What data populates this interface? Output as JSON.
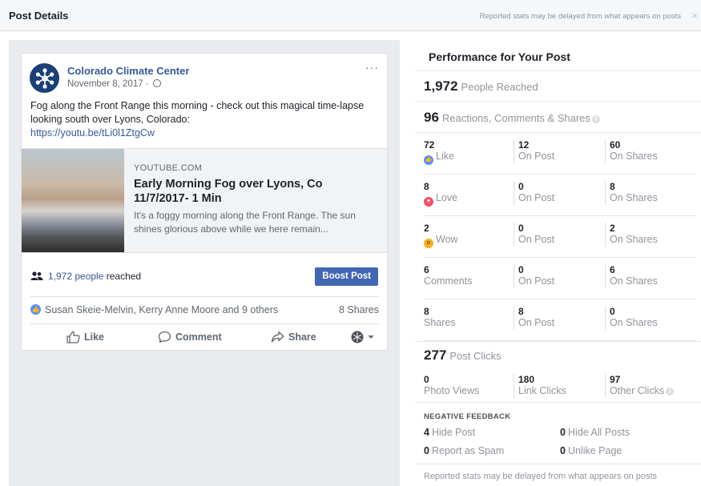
{
  "header": {
    "title": "Post Details",
    "note": "Reported stats may be delayed from what appears on posts",
    "close": "×"
  },
  "post": {
    "page_name": "Colorado Climate Center",
    "date": "November 8, 2017 ·",
    "more": "···",
    "text": "Fog along the Front Range this morning - check out this magical time-lapse looking south over Lyons, Colorado:",
    "link": "https://youtu.be/tLi0l1ZtgCw",
    "preview": {
      "source": "YOUTUBE.COM",
      "title": "Early Morning Fog over Lyons, Co 11/7/2017- 1 Min",
      "description": "It's a foggy morning along the Front Range. The sun shines glorious above while we here remain..."
    },
    "reach": {
      "link_text": "1,972 people",
      "suffix": " reached"
    },
    "boost_label": "Boost Post",
    "likes_text": "Susan Skeie-Melvin, Kerry Anne Moore and 9 others",
    "shares_text": "8 Shares",
    "actions": {
      "like": "Like",
      "comment": "Comment",
      "share": "Share"
    }
  },
  "performance": {
    "title": "Performance for Your Post",
    "reached": {
      "value": "1,972",
      "label": "People Reached"
    },
    "engagement": {
      "value": "96",
      "label": "Reactions, Comments & Shares"
    },
    "rows": [
      {
        "c1_num": "72",
        "c1_label": "Like",
        "c2_num": "12",
        "c2_label": "On Post",
        "c3_num": "60",
        "c3_label": "On Shares"
      },
      {
        "c1_num": "8",
        "c1_label": "Love",
        "c2_num": "0",
        "c2_label": "On Post",
        "c3_num": "8",
        "c3_label": "On Shares"
      },
      {
        "c1_num": "2",
        "c1_label": "Wow",
        "c2_num": "0",
        "c2_label": "On Post",
        "c3_num": "2",
        "c3_label": "On Shares"
      },
      {
        "c1_num": "6",
        "c1_label": "Comments",
        "c2_num": "0",
        "c2_label": "On Post",
        "c3_num": "6",
        "c3_label": "On Shares"
      },
      {
        "c1_num": "8",
        "c1_label": "Shares",
        "c2_num": "8",
        "c2_label": "On Post",
        "c3_num": "0",
        "c3_label": "On Shares"
      }
    ],
    "clicks": {
      "value": "277",
      "label": "Post Clicks"
    },
    "click_row": {
      "c1_num": "0",
      "c1_label": "Photo Views",
      "c2_num": "180",
      "c2_label": "Link Clicks",
      "c3_num": "97",
      "c3_label": "Other Clicks"
    },
    "negative": {
      "title": "NEGATIVE FEEDBACK",
      "hide_post": {
        "value": "4",
        "label": "Hide Post"
      },
      "hide_all": {
        "value": "0",
        "label": "Hide All Posts"
      },
      "spam": {
        "value": "0",
        "label": "Report as Spam"
      },
      "unlike": {
        "value": "0",
        "label": "Unlike Page"
      }
    },
    "footer": "Reported stats may be delayed from what appears on posts"
  },
  "colors": {
    "brand_blue": "#4267b2",
    "link_blue": "#365899",
    "like_blue": "#5890ff",
    "love_red": "#f25268",
    "wow_yellow": "#f7b125"
  }
}
